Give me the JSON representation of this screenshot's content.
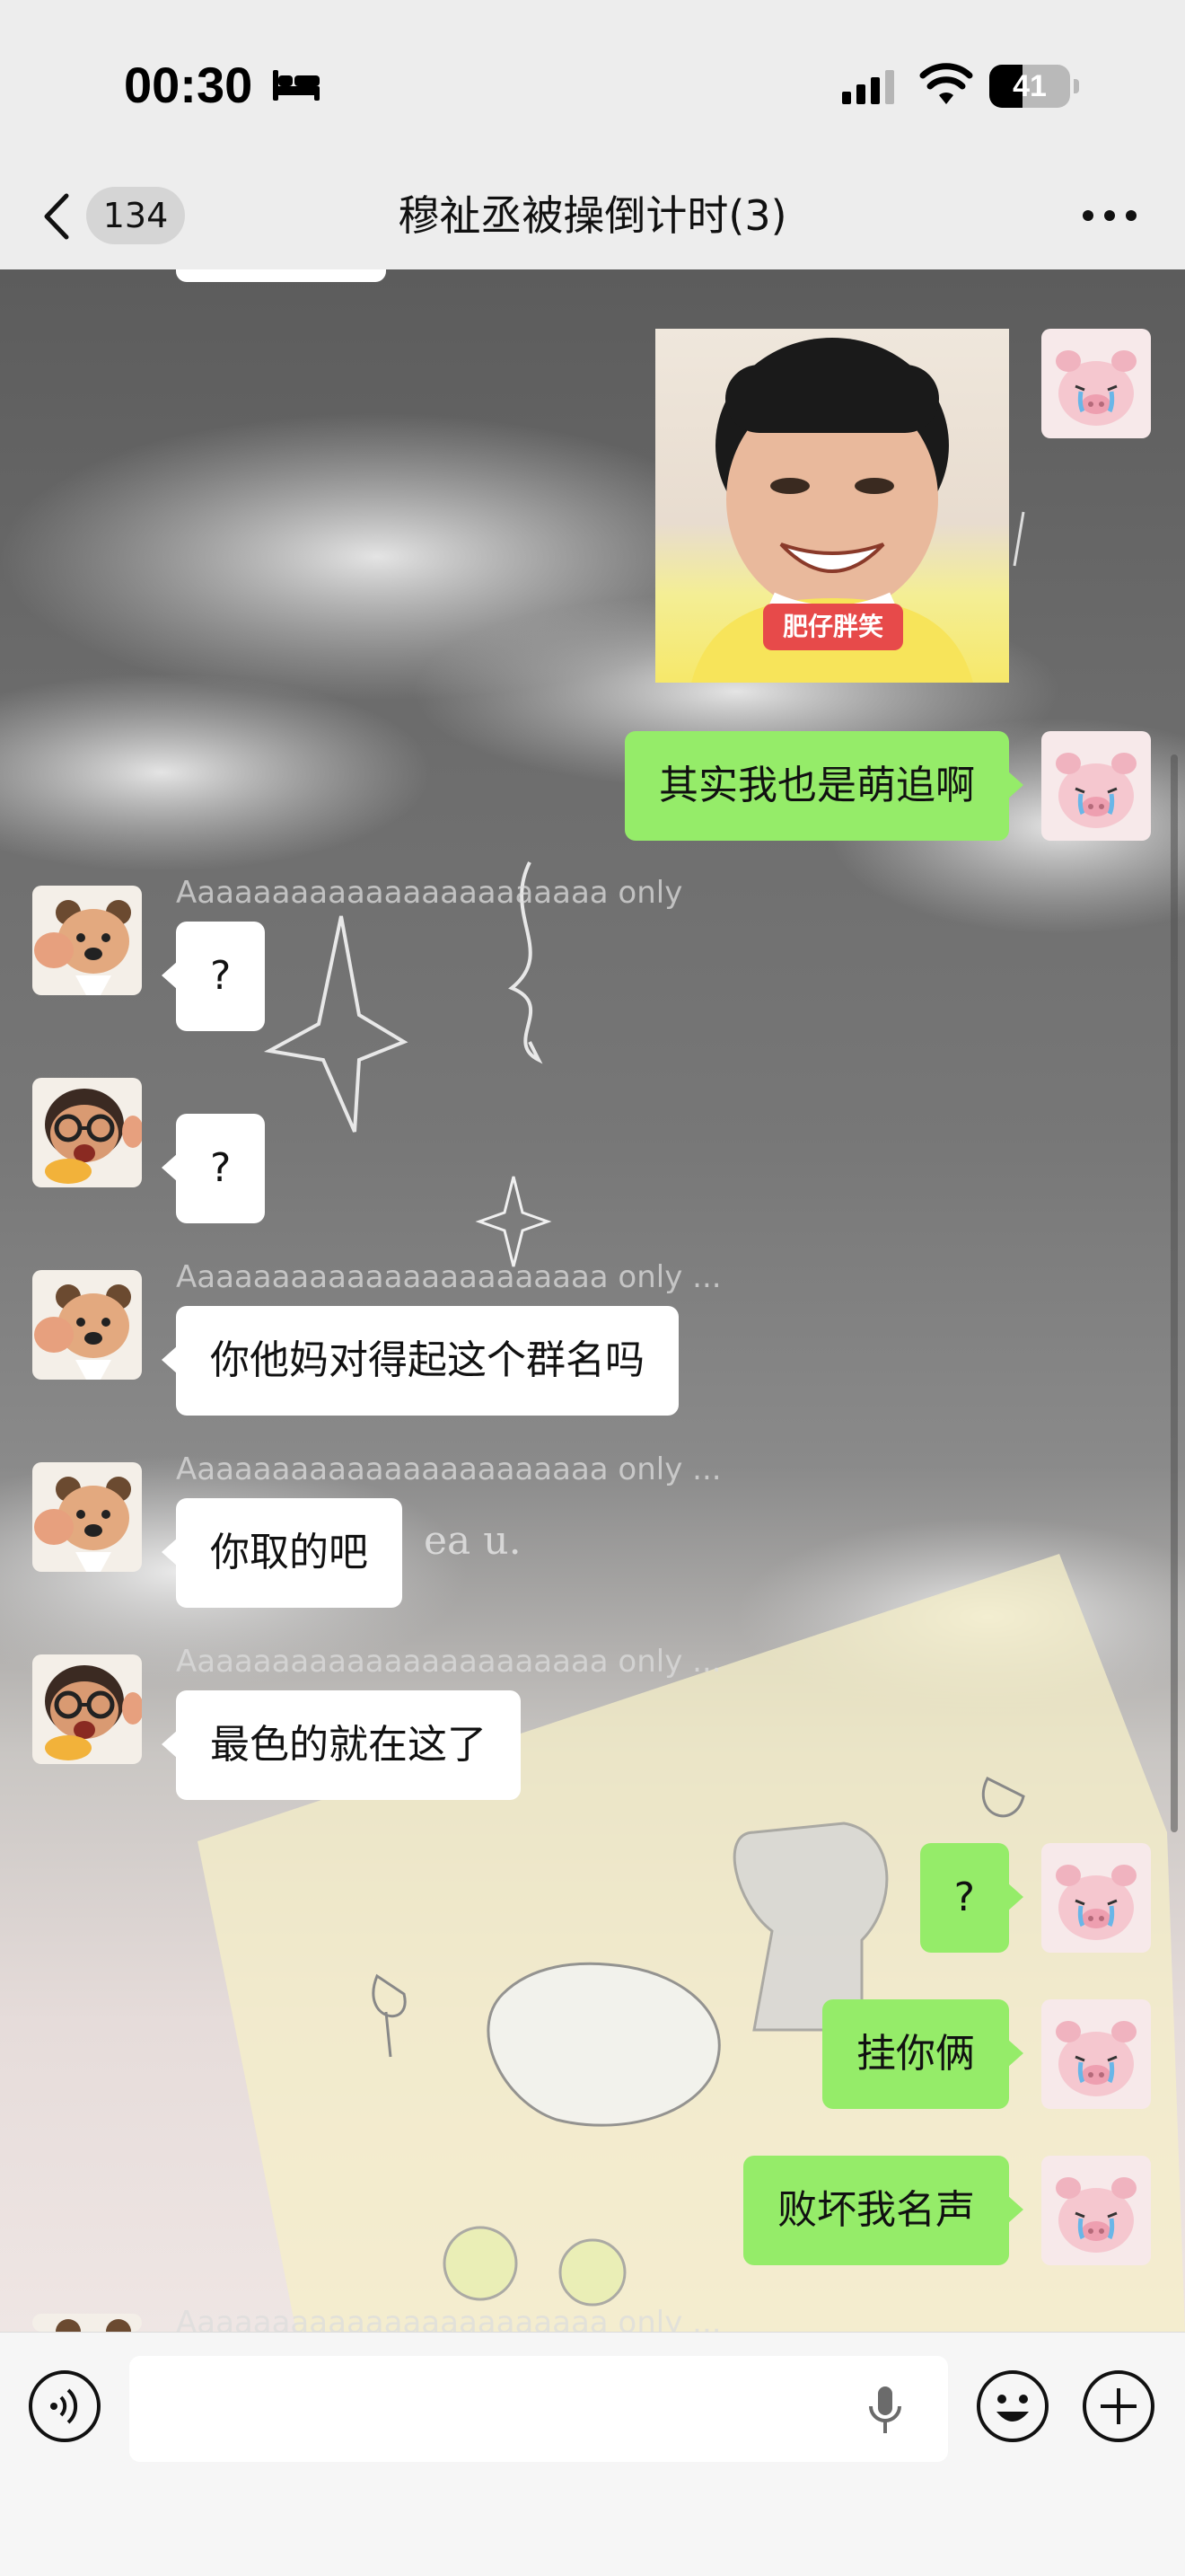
{
  "status_bar": {
    "time": "00:30",
    "battery_level": "41",
    "battery_fraction": 0.41,
    "icons": [
      "bed-icon",
      "cellular-signal-icon",
      "wifi-icon",
      "battery-icon"
    ]
  },
  "nav": {
    "back_icon": "chevron-left-icon",
    "unread_count": "134",
    "title": "穆祉丞被操倒计时(3)",
    "more_icon": "more-dots-icon"
  },
  "messages": [
    {
      "side": "right",
      "type": "image",
      "avatar": "pig-avatar",
      "caption": "肥仔胖笑"
    },
    {
      "side": "right",
      "type": "text",
      "avatar": "pig-avatar",
      "text": "其实我也是萌追啊"
    },
    {
      "side": "left",
      "type": "text",
      "avatar": "bear-avatar",
      "sender": "Aaaaaaaaaaaaaaaaaaaaaaa only",
      "text": "?"
    },
    {
      "side": "left",
      "type": "text",
      "avatar": "glasses-avatar",
      "sender": "",
      "text": "?"
    },
    {
      "side": "left",
      "type": "text",
      "avatar": "bear-avatar",
      "sender": "Aaaaaaaaaaaaaaaaaaaaaaa only ...",
      "text": "你他妈对得起这个群名吗"
    },
    {
      "side": "left",
      "type": "text",
      "avatar": "bear-avatar",
      "sender": "Aaaaaaaaaaaaaaaaaaaaaaa only ...",
      "text": "你取的吧"
    },
    {
      "side": "left",
      "type": "text",
      "avatar": "glasses-avatar",
      "sender": "Aaaaaaaaaaaaaaaaaaaaaaa only ...",
      "text": "最色的就在这了"
    },
    {
      "side": "right",
      "type": "text",
      "avatar": "pig-avatar",
      "text": "?"
    },
    {
      "side": "right",
      "type": "text",
      "avatar": "pig-avatar",
      "text": "挂你俩"
    },
    {
      "side": "right",
      "type": "text",
      "avatar": "pig-avatar",
      "text": "败坏我名声"
    },
    {
      "side": "left",
      "type": "text",
      "avatar": "bear-avatar",
      "sender": "Aaaaaaaaaaaaaaaaaaaaaaa only ...",
      "text": ""
    }
  ],
  "background_text": "ea u.",
  "input_bar": {
    "voice_icon": "voice-mode-icon",
    "mic_icon": "microphone-icon",
    "emoji_icon": "emoji-icon",
    "plus_icon": "plus-circle-icon",
    "input_value": ""
  },
  "colors": {
    "sent_bubble": "#95ec69",
    "received_bubble": "#ffffff",
    "bar_background": "#ededed"
  }
}
